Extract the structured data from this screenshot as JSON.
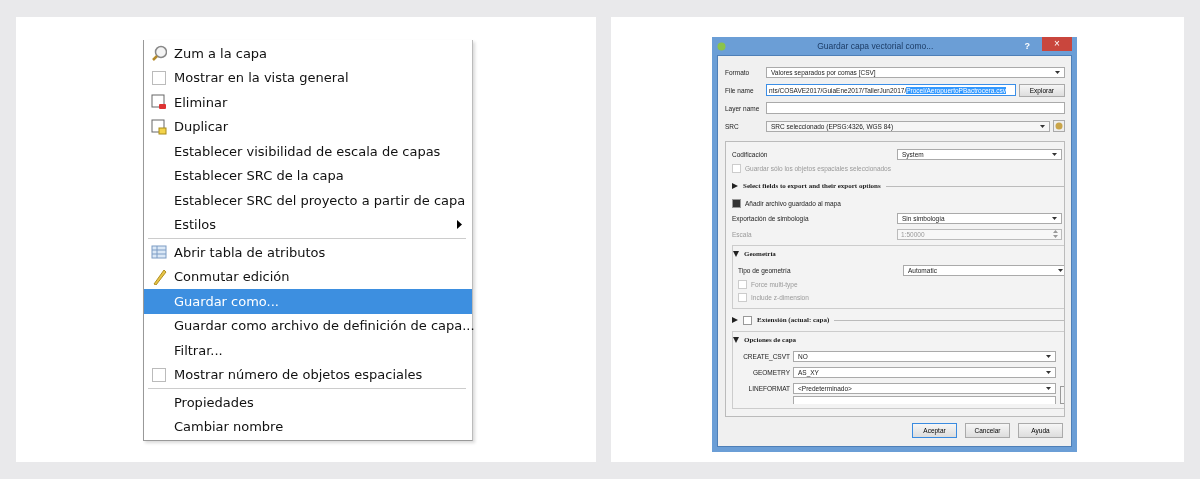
{
  "menu": {
    "items": [
      {
        "kind": "zoom",
        "label": "Zum a la capa",
        "selected": false
      },
      {
        "kind": "checkbox",
        "label": "Mostrar en la vista general",
        "checked": false,
        "selected": false
      },
      {
        "kind": "remove",
        "label": "Eliminar",
        "selected": false
      },
      {
        "kind": "duplicate",
        "label": "Duplicar",
        "selected": false
      },
      {
        "kind": "plain",
        "label": "Establecer visibilidad de escala de capas",
        "selected": false
      },
      {
        "kind": "plain",
        "label": "Establecer SRC de la capa",
        "selected": false
      },
      {
        "kind": "plain",
        "label": "Establecer SRC del proyecto a partir de capa",
        "selected": false
      },
      {
        "kind": "submenu",
        "label": "Estilos",
        "selected": false
      },
      {
        "kind": "separator"
      },
      {
        "kind": "table",
        "label": "Abrir tabla de atributos",
        "selected": false
      },
      {
        "kind": "edit",
        "label": "Conmutar edición",
        "selected": false
      },
      {
        "kind": "plain",
        "label": "Guardar como...",
        "selected": true
      },
      {
        "kind": "plain",
        "label": "Guardar como archivo de definición de capa...",
        "selected": false
      },
      {
        "kind": "plain",
        "label": "Filtrar...",
        "selected": false
      },
      {
        "kind": "checkbox",
        "label": "Mostrar número de objetos espaciales",
        "checked": false,
        "selected": false
      },
      {
        "kind": "separator"
      },
      {
        "kind": "plain",
        "label": "Propiedades",
        "selected": false
      },
      {
        "kind": "plain",
        "label": "Cambiar nombre",
        "selected": false
      }
    ]
  },
  "dialog": {
    "title": "Guardar capa vectorial como...",
    "help": "?",
    "close": "×",
    "fields": [
      {
        "kind": "combo",
        "label": "Formato",
        "value": "Valores separados por comas [CSV]"
      },
      {
        "kind": "file",
        "label": "File name",
        "value": "nts/COSAVE2017/GuiaEne2017/TallerJun2017/",
        "value_selected": "Procel/AeropuertoPBactrocera.csv",
        "button": "Explorar"
      },
      {
        "kind": "text",
        "label": "Layer name"
      },
      {
        "kind": "crs",
        "label": "SRC",
        "value": "SRC seleccionado (EPSG:4326, WGS 84)"
      }
    ],
    "options": [
      {
        "kind": "combo",
        "label": "Codificación",
        "value": "System"
      },
      {
        "kind": "checkbox",
        "label": "Guardar sólo los objetos espaciales seleccionados",
        "checked": false,
        "disabled": true
      },
      {
        "kind": "group",
        "label": "Select fields to export and their export options",
        "expanded": false
      },
      {
        "kind": "checkbox",
        "label": "Añadir archivo guardado al mapa",
        "checked": true,
        "disabled": false
      },
      {
        "kind": "combo",
        "label": "Exportación de simbología",
        "value": "Sin simbología"
      },
      {
        "kind": "spin",
        "label": "Escala",
        "value": "1:50000",
        "disabled": true
      },
      {
        "kind": "group",
        "label": "Geometría",
        "expanded": true,
        "children": [
          {
            "kind": "combo",
            "label": "Tipo de geometría",
            "value": "Automatic"
          },
          {
            "kind": "checkbox",
            "label": "Force multi-type",
            "checked": false,
            "disabled": true
          },
          {
            "kind": "checkbox",
            "label": "Include z-dimension",
            "checked": false,
            "disabled": true
          }
        ]
      },
      {
        "kind": "group",
        "label": "Extensión (actual: capa)",
        "expanded": false,
        "checked": false
      },
      {
        "kind": "group",
        "label": "Opciones de capa",
        "expanded": true,
        "children": [
          {
            "kind": "option",
            "label": "CREATE_CSVT",
            "value": "NO"
          },
          {
            "kind": "option",
            "label": "GEOMETRY",
            "value": "AS_XY"
          },
          {
            "kind": "option",
            "label": "LINEFORMAT",
            "value": "<Predeterminado>"
          }
        ]
      }
    ],
    "buttons": [
      {
        "label": "Aceptar",
        "default": true
      },
      {
        "label": "Cancelar",
        "default": false
      },
      {
        "label": "Ayuda",
        "default": false
      }
    ]
  }
}
